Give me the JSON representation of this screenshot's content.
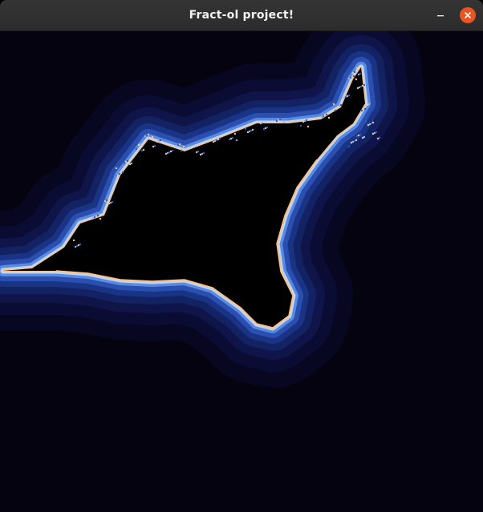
{
  "window": {
    "title": "Fract-ol project!"
  },
  "controls": {
    "minimize_icon": "minimize-icon",
    "close_icon": "close-icon",
    "close_color": "#e95420"
  },
  "fractal": {
    "background_color": "#04030f",
    "set_color": "#000000",
    "band_colors": [
      "#080721",
      "#0b0c33",
      "#0f1548",
      "#132263",
      "#1a3485",
      "#2a4fb0",
      "#5a8be0",
      "#bcd6f8",
      "#f7c28b"
    ]
  }
}
